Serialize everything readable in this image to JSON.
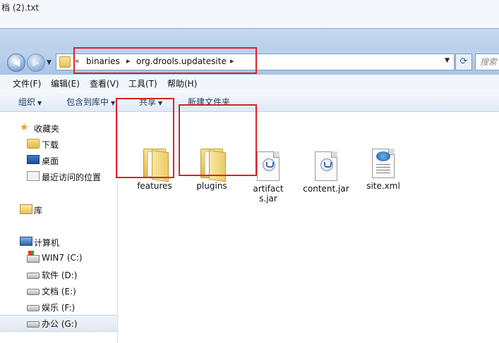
{
  "desktop": {
    "title_fragment": "档 (2).txt"
  },
  "nav": {
    "back_glyph": "◀",
    "forward_glyph": "▶",
    "breadcrumb_prefix": "«",
    "breadcrumbs": [
      "binaries",
      "org.drools.updatesite"
    ],
    "refresh_glyph": "⟳",
    "search_placeholder": "搜索"
  },
  "menu": [
    "文件(F)",
    "编辑(E)",
    "查看(V)",
    "工具(T)",
    "帮助(H)"
  ],
  "toolbar": {
    "organize": "组织",
    "include_in_library": "包含到库中",
    "share": "共享",
    "new_folder": "新建文件夹"
  },
  "sidebar": {
    "favorites": {
      "label": "收藏夹",
      "icon": "star-icon"
    },
    "favorite_items": [
      {
        "label": "下载",
        "icon": "download-folder-icon"
      },
      {
        "label": "桌面",
        "icon": "desktop-icon"
      },
      {
        "label": "最近访问的位置",
        "icon": "recent-places-icon"
      }
    ],
    "libraries": {
      "label": "库",
      "icon": "library-icon"
    },
    "computer": {
      "label": "计算机",
      "icon": "computer-icon"
    },
    "drives": [
      {
        "label": "WIN7 (C:)",
        "icon": "system-drive-icon"
      },
      {
        "label": "软件 (D:)",
        "icon": "drive-icon"
      },
      {
        "label": "文档 (E:)",
        "icon": "drive-icon"
      },
      {
        "label": "娱乐 (F:)",
        "icon": "drive-icon"
      },
      {
        "label": "办公 (G:)",
        "icon": "drive-icon",
        "selected": true
      }
    ]
  },
  "files": [
    {
      "name": "features",
      "type": "folder"
    },
    {
      "name": "plugins",
      "type": "folder"
    },
    {
      "name": "artifacts.jar",
      "type": "jar"
    },
    {
      "name": "content.jar",
      "type": "jar"
    },
    {
      "name": "site.xml",
      "type": "xml"
    }
  ],
  "colors": {
    "highlight_box": "#d8232a",
    "chrome_blue": "#b9cfe9"
  }
}
